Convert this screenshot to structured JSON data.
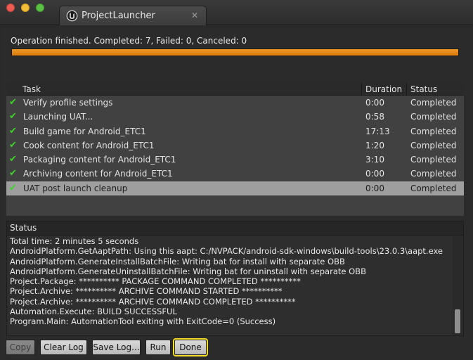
{
  "window": {
    "tab_title": "ProjectLauncher",
    "tab_close": "✕"
  },
  "operation": {
    "status_text": "Operation finished. Completed: 7, Failed: 0, Canceled: 0",
    "progress_percent": 100
  },
  "task_table": {
    "headers": {
      "task": "Task",
      "duration": "Duration",
      "status": "Status"
    },
    "rows": [
      {
        "task": "Verify profile settings",
        "duration": "0:00",
        "status": "Completed"
      },
      {
        "task": "Launching UAT...",
        "duration": "0:58",
        "status": "Completed"
      },
      {
        "task": "Build game for Android_ETC1",
        "duration": "17:13",
        "status": "Completed"
      },
      {
        "task": "Cook content for Android_ETC1",
        "duration": "1:20",
        "status": "Completed"
      },
      {
        "task": "Packaging content for Android_ETC1",
        "duration": "3:10",
        "status": "Completed"
      },
      {
        "task": "Archiving content for Android_ETC1",
        "duration": "0:00",
        "status": "Completed"
      },
      {
        "task": "UAT post launch cleanup",
        "duration": "0:00",
        "status": "Completed"
      }
    ],
    "selected_row": 6
  },
  "status_log": {
    "header": "Status",
    "lines": [
      "Total time: 2 minutes 5 seconds",
      "AndroidPlatform.GetAaptPath: Using this aapt: C:/NVPACK/android-sdk-windows\\build-tools\\23.0.3\\aapt.exe",
      "AndroidPlatform.GenerateInstallBatchFile: Writing bat for install with separate OBB",
      "AndroidPlatform.GenerateUninstallBatchFile: Writing bat for uninstall with separate OBB",
      "Project.Package: ********** PACKAGE COMMAND COMPLETED **********",
      "Project.Archive: ********** ARCHIVE COMMAND STARTED **********",
      "Project.Archive: ********** ARCHIVE COMMAND COMPLETED **********",
      "Automation.Execute: BUILD SUCCESSFUL",
      "Program.Main: AutomationTool exiting with ExitCode=0 (Success)"
    ]
  },
  "buttons": {
    "copy": "Copy",
    "clear_log": "Clear Log",
    "save_log": "Save Log...",
    "run": "Run",
    "done": "Done"
  },
  "icons": {
    "check": "check-icon",
    "app": "unreal-logo-icon"
  },
  "colors": {
    "progress": "#e8860f",
    "check": "#3fd22b",
    "focus": "#f5de2a"
  }
}
